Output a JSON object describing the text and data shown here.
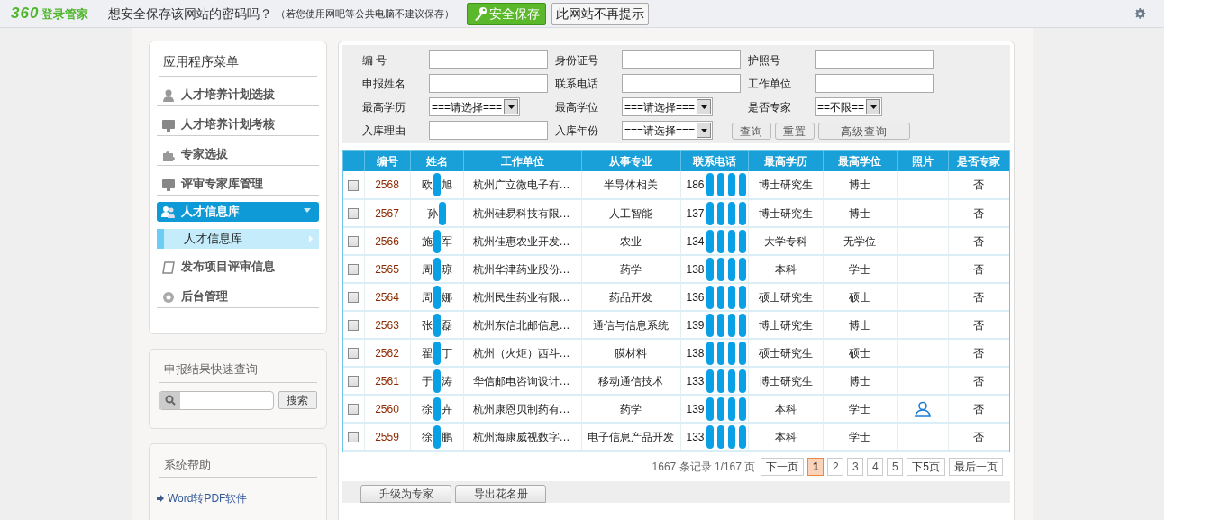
{
  "top_bar": {
    "logo_mark": "360",
    "logo_text": "登录管家",
    "prompt": "想安全保存该网站的密码吗？",
    "note": "（若您使用网吧等公共电脑不建议保存）",
    "save_button": "安全保存",
    "dismiss_button": "此网站不再提示"
  },
  "sidebar": {
    "menu_title": "应用程序菜单",
    "items": [
      {
        "kind": "item",
        "label": "人才培养计划选拔",
        "selected": false
      },
      {
        "kind": "item",
        "label": "人才培养计划考核",
        "selected": false
      },
      {
        "kind": "item",
        "label": "专家选拔",
        "selected": false
      },
      {
        "kind": "item",
        "label": "评审专家库管理",
        "selected": false
      },
      {
        "kind": "item",
        "label": "人才信息库",
        "selected": true,
        "expanded": true,
        "children": [
          {
            "label": "人才信息库",
            "selected": true
          }
        ]
      },
      {
        "kind": "item",
        "label": "发布项目评审信息",
        "selected": false
      },
      {
        "kind": "item",
        "label": "后台管理",
        "selected": false
      }
    ],
    "quick_search": {
      "title": "申报结果快速查询",
      "button": "搜索"
    },
    "help": {
      "title": "系统帮助",
      "links": [
        "Word转PDF软件"
      ]
    }
  },
  "filters": [
    {
      "kind": "input",
      "label": "编 号"
    },
    {
      "kind": "input",
      "label": "身份证号"
    },
    {
      "kind": "input",
      "label": "护照号"
    },
    {
      "kind": "input",
      "label": "申报姓名"
    },
    {
      "kind": "input",
      "label": "联系电话"
    },
    {
      "kind": "input",
      "label": "工作单位"
    },
    {
      "kind": "select",
      "label": "最高学历",
      "value": "===请选择==="
    },
    {
      "kind": "select",
      "label": "最高学位",
      "value": "===请选择==="
    },
    {
      "kind": "select",
      "label": "是否专家",
      "value": "==不限=="
    },
    {
      "kind": "input",
      "label": "入库理由"
    },
    {
      "kind": "select",
      "label": "入库年份",
      "value": "===请选择==="
    }
  ],
  "filter_buttons": [
    "查询",
    "重置",
    "高级查询"
  ],
  "table": {
    "columns": [
      "编号",
      "姓名",
      "工作单位",
      "从事专业",
      "联系电话",
      "最高学历",
      "最高学位",
      "照片",
      "是否专家"
    ],
    "rows": [
      {
        "checked": false,
        "id": "2568",
        "name": [
          "欧",
          "旭"
        ],
        "company": "杭州广立微电子有…",
        "field": "半导体相关",
        "phone": "186",
        "education": "博士研究生",
        "degree": "博士",
        "photo": false,
        "expert": "否"
      },
      {
        "checked": false,
        "id": "2567",
        "name": [
          "孙"
        ],
        "company": "杭州硅易科技有限…",
        "field": "人工智能",
        "phone": "137",
        "education": "博士研究生",
        "degree": "博士",
        "photo": false,
        "expert": "否"
      },
      {
        "checked": false,
        "id": "2566",
        "name": [
          "施",
          "军"
        ],
        "company": "杭州佳惠农业开发…",
        "field": "农业",
        "phone": "134",
        "education": "大学专科",
        "degree": "无学位",
        "photo": false,
        "expert": "否"
      },
      {
        "checked": false,
        "id": "2565",
        "name": [
          "周",
          "琼"
        ],
        "company": "杭州华津药业股份…",
        "field": "药学",
        "phone": "138",
        "education": "本科",
        "degree": "学士",
        "photo": false,
        "expert": "否"
      },
      {
        "checked": false,
        "id": "2564",
        "name": [
          "周",
          "娜"
        ],
        "company": "杭州民生药业有限…",
        "field": "药品开发",
        "phone": "136",
        "education": "硕士研究生",
        "degree": "硕士",
        "photo": false,
        "expert": "否"
      },
      {
        "checked": false,
        "id": "2563",
        "name": [
          "张",
          "磊"
        ],
        "company": "杭州东信北邮信息…",
        "field": "通信与信息系统",
        "phone": "139",
        "education": "博士研究生",
        "degree": "博士",
        "photo": false,
        "expert": "否"
      },
      {
        "checked": false,
        "id": "2562",
        "name": [
          "翟",
          "丁"
        ],
        "company": "杭州（火炬）西斗…",
        "field": "膜材料",
        "phone": "138",
        "education": "硕士研究生",
        "degree": "硕士",
        "photo": false,
        "expert": "否"
      },
      {
        "checked": false,
        "id": "2561",
        "name": [
          "于",
          "涛"
        ],
        "company": "华信邮电咨询设计…",
        "field": "移动通信技术",
        "phone": "133",
        "education": "博士研究生",
        "degree": "博士",
        "photo": false,
        "expert": "否"
      },
      {
        "checked": false,
        "id": "2560",
        "name": [
          "徐",
          "卉"
        ],
        "company": "杭州康恩贝制药有…",
        "field": "药学",
        "phone": "139",
        "education": "本科",
        "degree": "学士",
        "photo": true,
        "expert": "否"
      },
      {
        "checked": false,
        "id": "2559",
        "name": [
          "徐",
          "鹏"
        ],
        "company": "杭州海康威视数字…",
        "field": "电子信息产品开发",
        "phone": "133",
        "education": "本科",
        "degree": "学士",
        "photo": false,
        "expert": "否"
      }
    ]
  },
  "pagination": {
    "summary": "1667 条记录 1/167 页",
    "next": "下一页",
    "pages": [
      {
        "label": "1",
        "selected": true
      },
      {
        "label": "2",
        "selected": false
      },
      {
        "label": "3",
        "selected": false
      },
      {
        "label": "4",
        "selected": false
      },
      {
        "label": "5",
        "selected": false
      }
    ],
    "next5": "下5页",
    "last": "最后一页"
  },
  "actions": [
    "升级为专家",
    "导出花名册"
  ]
}
